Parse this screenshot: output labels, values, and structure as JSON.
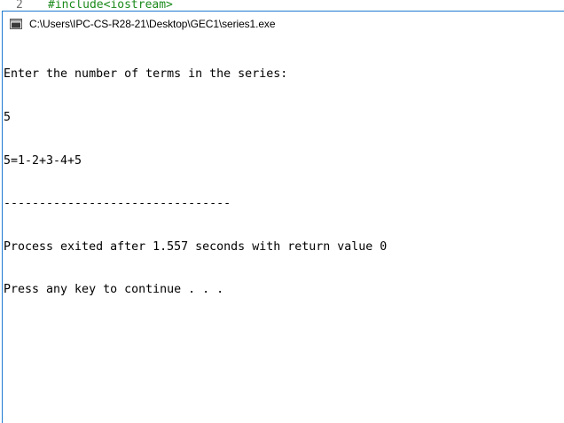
{
  "editor": {
    "line_number": "2",
    "code": "#include<iostream>"
  },
  "window": {
    "title": "C:\\Users\\IPC-CS-R28-21\\Desktop\\GEC1\\series1.exe",
    "icon": "console-app-icon"
  },
  "console": {
    "lines": [
      "Enter the number of terms in the series:",
      "5",
      "5=1-2+3-4+5",
      "--------------------------------",
      "Process exited after 1.557 seconds with return value 0",
      "Press any key to continue . . ."
    ]
  }
}
